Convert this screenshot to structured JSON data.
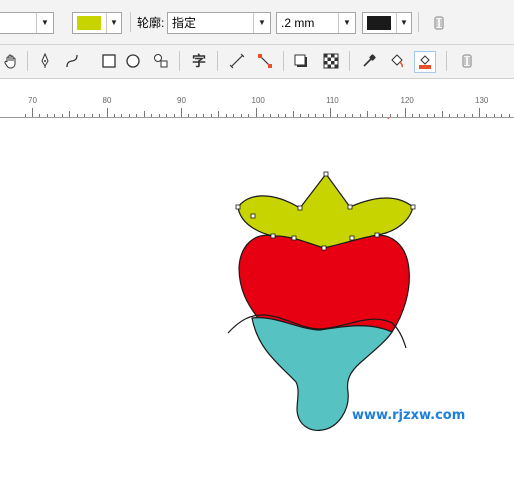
{
  "property_bar": {
    "fill_color": "#c8d400",
    "outline_label": "轮廓:",
    "outline_style_value": "指定",
    "outline_width_value": ".2 mm",
    "outline_color": "#1a1a1a"
  },
  "toolbox": {
    "text_tool_glyph": "字"
  },
  "ruler": {
    "labels": [
      "70",
      "80",
      "90",
      "100",
      "110",
      "120",
      "130"
    ]
  },
  "drawing": {
    "leaf_color": "#c8d400",
    "body_color": "#e60012",
    "base_color": "#56c2c2",
    "outline_color": "#1a1a1a"
  },
  "annotations": {
    "arrow_color": "#ee3322"
  },
  "watermark": "www.rjzxw.com"
}
